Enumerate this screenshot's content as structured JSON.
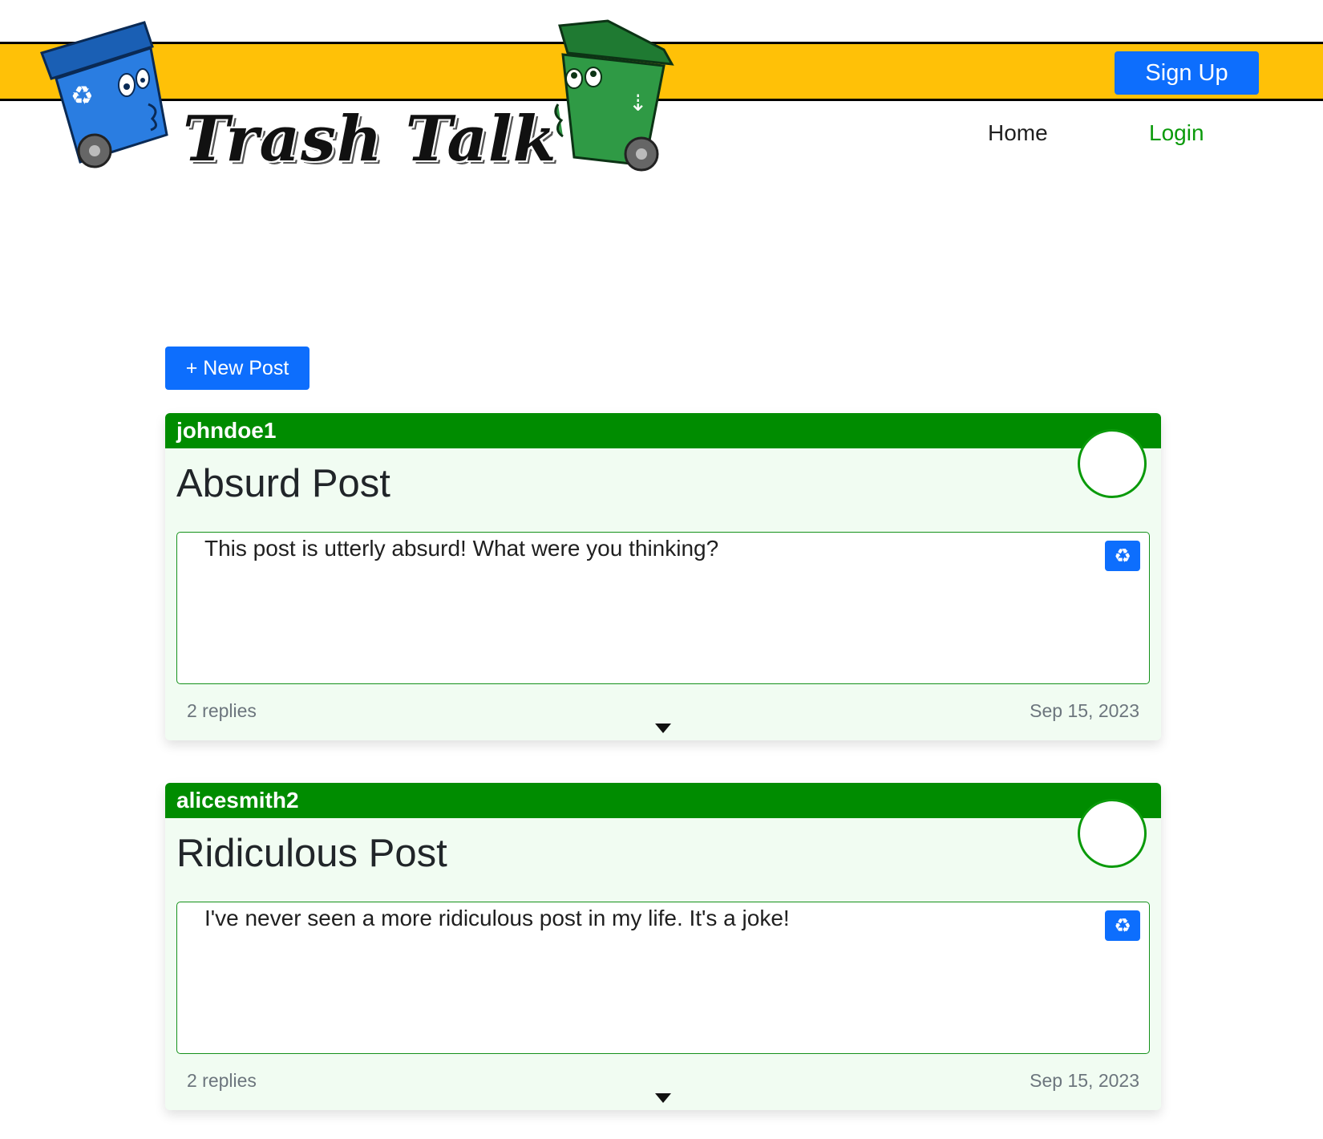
{
  "header": {
    "logo_text": "Trash Talk",
    "signup_label": "Sign Up",
    "nav": [
      {
        "label": "Home"
      },
      {
        "label": "Login"
      }
    ],
    "banner_color": "#ffc107"
  },
  "main": {
    "new_post_label": "+ New Post",
    "posts": [
      {
        "username": "johndoe1",
        "title": "Absurd Post",
        "body": "This post is utterly absurd! What were you thinking?",
        "replies": "2 replies",
        "date": "Sep 15, 2023",
        "recycle_icon": "recycle-icon",
        "expand_icon": "caret-down-icon"
      },
      {
        "username": "alicesmith2",
        "title": "Ridiculous Post",
        "body": "I've never seen a more ridiculous post in my life. It's a joke!",
        "replies": "2 replies",
        "date": "Sep 15, 2023",
        "recycle_icon": "recycle-icon",
        "expand_icon": "caret-down-icon"
      }
    ]
  },
  "colors": {
    "accent_blue": "#0d6efd",
    "post_header_green": "#008c00",
    "login_green": "#0a9a0a",
    "card_background": "#f1fcf2"
  }
}
